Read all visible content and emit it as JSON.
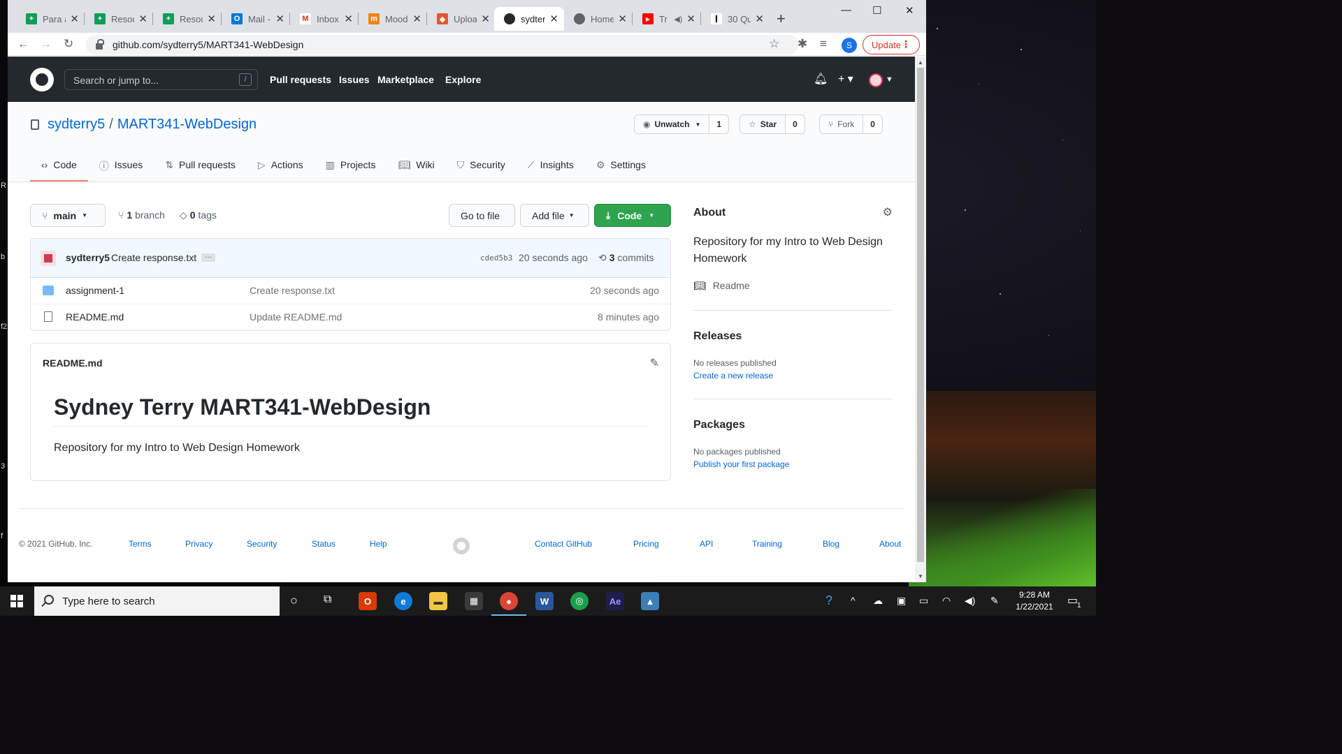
{
  "browser": {
    "tabs": [
      {
        "title": "Para a",
        "fav_color": "#0f9d58",
        "fav_glyph": "+"
      },
      {
        "title": "Resou",
        "fav_color": "#0f9d58",
        "fav_glyph": "+"
      },
      {
        "title": "Resou",
        "fav_color": "#0f9d58",
        "fav_glyph": "+"
      },
      {
        "title": "Mail -",
        "fav_color": "#0078d4",
        "fav_glyph": "O"
      },
      {
        "title": "Inbox",
        "fav_color": "#ffffff",
        "fav_glyph": "M"
      },
      {
        "title": "Mood",
        "fav_color": "#f98012",
        "fav_glyph": "m"
      },
      {
        "title": "Uploa",
        "fav_color": "#e4572e",
        "fav_glyph": "◆"
      },
      {
        "title": "sydter",
        "fav_color": "#24292e",
        "fav_glyph": "●"
      },
      {
        "title": "Home",
        "fav_color": "#5f6368",
        "fav_glyph": "◍"
      },
      {
        "title": "Tr",
        "fav_color": "#ff0000",
        "fav_glyph": "▶"
      },
      {
        "title": "30 Qu",
        "fav_color": "#000000",
        "fav_glyph": "I"
      }
    ],
    "url": "github.com/sydterry5/MART341-WebDesign",
    "profile_initial": "S",
    "update_label": "Update"
  },
  "header": {
    "search_placeholder": "Search or jump to...",
    "search_shortcut": "/",
    "nav": [
      "Pull requests",
      "Issues",
      "Marketplace",
      "Explore"
    ]
  },
  "repo": {
    "owner": "sydterry5",
    "name": "MART341-WebDesign",
    "watch_label": "Unwatch",
    "watch_count": "1",
    "star_label": "Star",
    "star_count": "0",
    "fork_label": "Fork",
    "fork_count": "0",
    "tabs": [
      "Code",
      "Issues",
      "Pull requests",
      "Actions",
      "Projects",
      "Wiki",
      "Security",
      "Insights",
      "Settings"
    ],
    "branch": "main",
    "branch_count": "1",
    "branch_word": "branch",
    "tag_count": "0",
    "tag_word": "tags",
    "go_to_file": "Go to file",
    "add_file": "Add file",
    "code_btn": "Code"
  },
  "commit": {
    "author": "sydterry5",
    "message": "Create response.txt",
    "sha": "cded5b3",
    "ago": "20 seconds ago",
    "count": "3",
    "count_word": "commits"
  },
  "files": [
    {
      "name": "assignment-1",
      "type": "folder",
      "message": "Create response.txt",
      "ago": "20 seconds ago"
    },
    {
      "name": "README.md",
      "type": "file",
      "message": "Update README.md",
      "ago": "8 minutes ago"
    }
  ],
  "readme": {
    "filename": "README.md",
    "heading": "Sydney Terry MART341-WebDesign",
    "body": "Repository for my Intro to Web Design Homework"
  },
  "about": {
    "title": "About",
    "description": "Repository for my Intro to Web Design Homework",
    "readme_label": "Readme",
    "releases_title": "Releases",
    "releases_text": "No releases published",
    "releases_link": "Create a new release",
    "packages_title": "Packages",
    "packages_text": "No packages published",
    "packages_link": "Publish your first package"
  },
  "footer": {
    "copyright": "© 2021 GitHub, Inc.",
    "left_links": [
      "Terms",
      "Privacy",
      "Security",
      "Status",
      "Help"
    ],
    "right_links": [
      "Contact GitHub",
      "Pricing",
      "API",
      "Training",
      "Blog",
      "About"
    ]
  },
  "taskbar": {
    "search_placeholder": "Type here to search",
    "time": "9:28 AM",
    "date": "1/22/2021",
    "notification_count": "1"
  }
}
